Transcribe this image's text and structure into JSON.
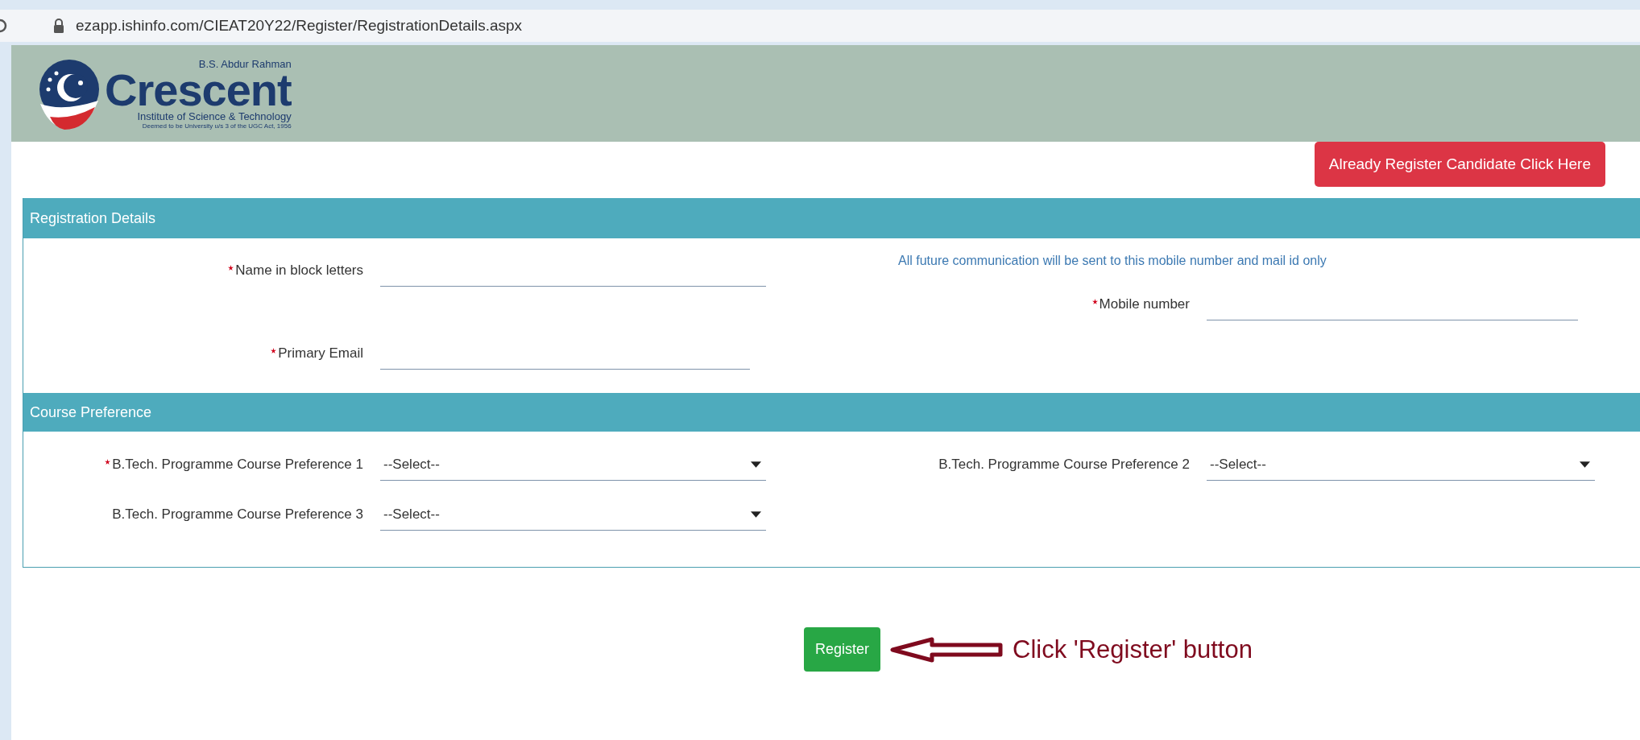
{
  "browser": {
    "url": "ezapp.ishinfo.com/CIEAT20Y22/Register/RegistrationDetails.aspx"
  },
  "logo": {
    "top_line": "B.S. Abdur Rahman",
    "name": "Crescent",
    "subtitle": "Institute of Science & Technology",
    "note": "Deemed to be University u/s 3 of the UGC Act, 1956"
  },
  "login_button": "Already Register Candidate Click Here",
  "registration": {
    "title": "Registration Details",
    "note": "All future communication will be sent to this mobile number and mail id only",
    "fields": [
      {
        "label": "Name in block letters",
        "required": true
      },
      {
        "label": "Mobile number",
        "required": true
      },
      {
        "label": "Primary Email",
        "required": true
      }
    ]
  },
  "course_preference": {
    "title": "Course Preference",
    "selects": [
      {
        "label": "B.Tech. Programme Course Preference 1",
        "required": true,
        "value": "--Select--"
      },
      {
        "label": "B.Tech. Programme Course Preference 2",
        "required": false,
        "value": "--Select--"
      },
      {
        "label": "B.Tech. Programme Course Preference 3",
        "required": false,
        "value": "--Select--"
      }
    ]
  },
  "register_button": "Register",
  "annotation": "Click 'Register' button"
}
